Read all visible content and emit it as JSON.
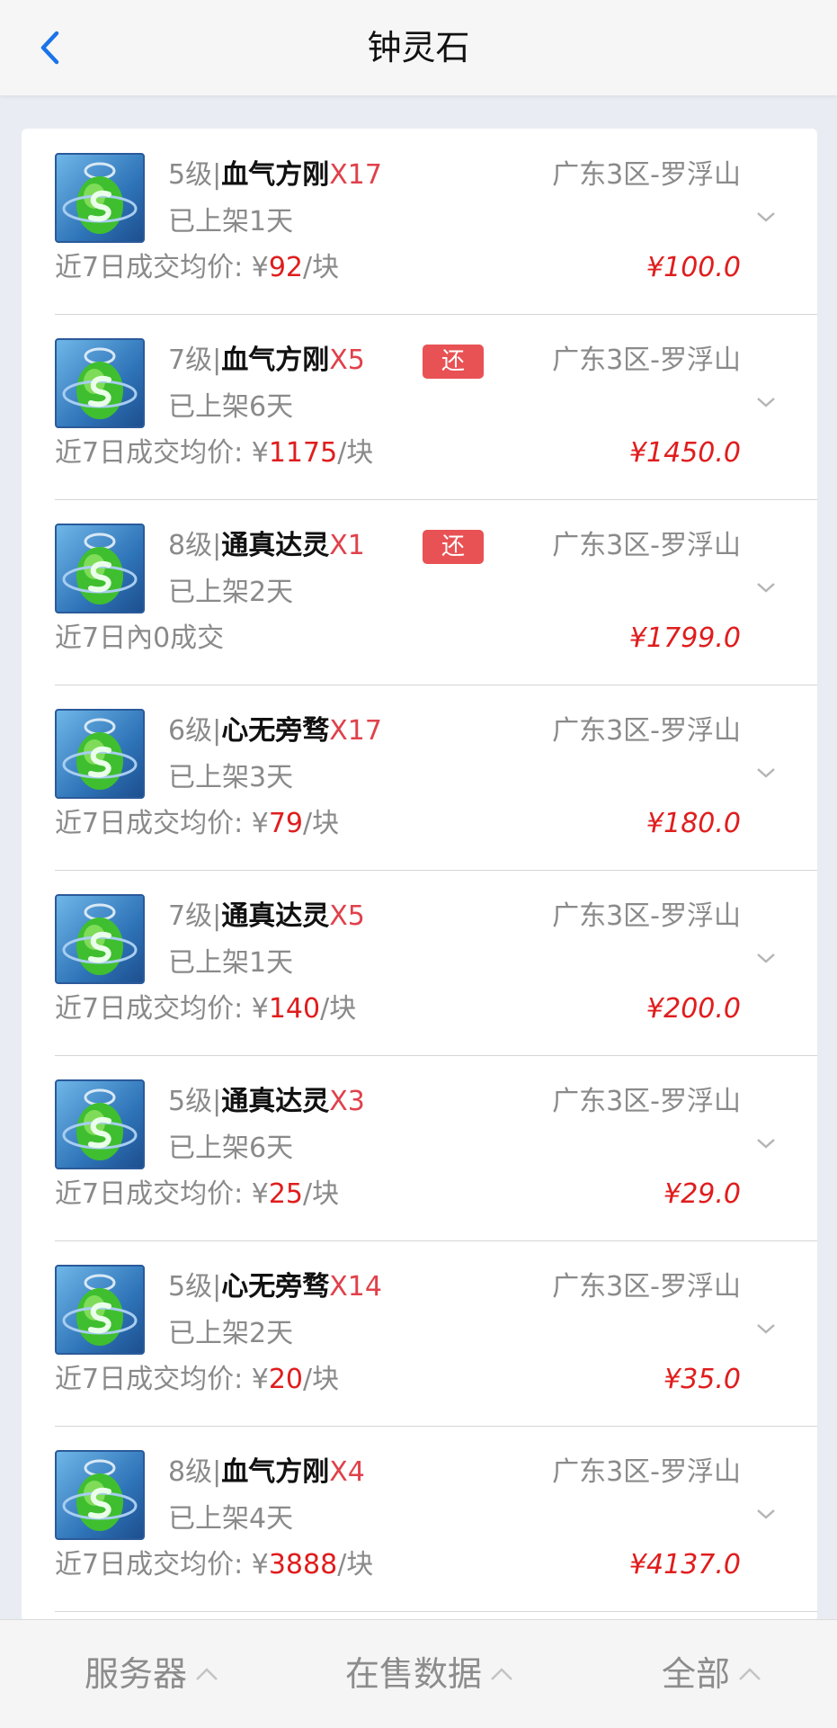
{
  "header": {
    "title": "钟灵石"
  },
  "footer": {
    "filters": [
      "服务器",
      "在售数据",
      "全部"
    ]
  },
  "items": [
    {
      "level": "5级|",
      "name": "血气方刚",
      "qty": "X17",
      "tag": "",
      "server": "广东3区-罗浮山",
      "listed": "已上架1天",
      "avg_prefix": "近7日成交均价: ¥",
      "avg_value": "92",
      "avg_suffix": "/块",
      "price": "¥100.0"
    },
    {
      "level": "7级|",
      "name": "血气方刚",
      "qty": "X5",
      "tag": "还",
      "server": "广东3区-罗浮山",
      "listed": "已上架6天",
      "avg_prefix": "近7日成交均价: ¥",
      "avg_value": "1175",
      "avg_suffix": "/块",
      "price": "¥1450.0"
    },
    {
      "level": "8级|",
      "name": "通真达灵",
      "qty": "X1",
      "tag": "还",
      "server": "广东3区-罗浮山",
      "listed": "已上架2天",
      "avg_prefix": "近7日內0成交",
      "avg_value": "",
      "avg_suffix": "",
      "price": "¥1799.0"
    },
    {
      "level": "6级|",
      "name": "心无旁骛",
      "qty": "X17",
      "tag": "",
      "server": "广东3区-罗浮山",
      "listed": "已上架3天",
      "avg_prefix": "近7日成交均价: ¥",
      "avg_value": "79",
      "avg_suffix": "/块",
      "price": "¥180.0"
    },
    {
      "level": "7级|",
      "name": "通真达灵",
      "qty": "X5",
      "tag": "",
      "server": "广东3区-罗浮山",
      "listed": "已上架1天",
      "avg_prefix": "近7日成交均价: ¥",
      "avg_value": "140",
      "avg_suffix": "/块",
      "price": "¥200.0"
    },
    {
      "level": "5级|",
      "name": "通真达灵",
      "qty": "X3",
      "tag": "",
      "server": "广东3区-罗浮山",
      "listed": "已上架6天",
      "avg_prefix": "近7日成交均价: ¥",
      "avg_value": "25",
      "avg_suffix": "/块",
      "price": "¥29.0"
    },
    {
      "level": "5级|",
      "name": "心无旁骛",
      "qty": "X14",
      "tag": "",
      "server": "广东3区-罗浮山",
      "listed": "已上架2天",
      "avg_prefix": "近7日成交均价: ¥",
      "avg_value": "20",
      "avg_suffix": "/块",
      "price": "¥35.0"
    },
    {
      "level": "8级|",
      "name": "血气方刚",
      "qty": "X4",
      "tag": "",
      "server": "广东3区-罗浮山",
      "listed": "已上架4天",
      "avg_prefix": "近7日成交均价: ¥",
      "avg_value": "3888",
      "avg_suffix": "/块",
      "price": "¥4137.0"
    }
  ]
}
